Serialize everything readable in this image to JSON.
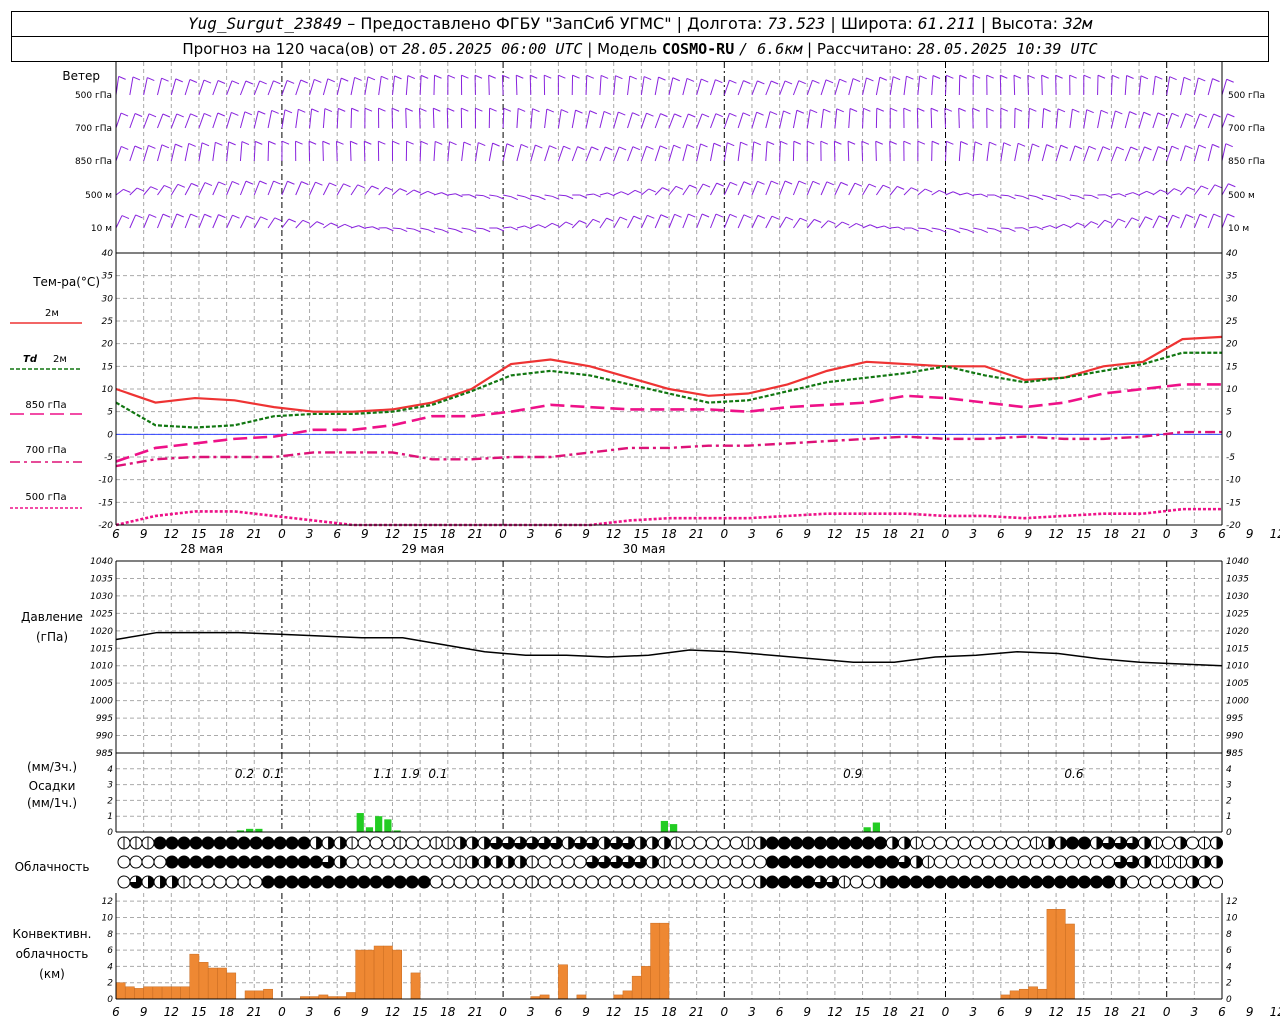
{
  "header": {
    "station": "Yug_Surgut_23849",
    "provider": "– Предоставлено ФГБУ \"ЗапСиб УГМС\"",
    "lon_label": "| Долгота:",
    "lon": "73.523",
    "lat_label": "| Широта:",
    "lat": "61.211",
    "alt_label": "| Высота:",
    "alt": "32м",
    "fc_label": "Прогноз на 120 часа(ов) от",
    "fc_start": "28.05.2025 06:00 UTC",
    "model_label": "| Модель",
    "model": "COSMO-RU",
    "res": "/ 6.6км",
    "calc_label": "| Рассчитано:",
    "calc_time": "28.05.2025 10:39 UTC"
  },
  "labels": {
    "wind": "Ветер",
    "wind_levels": [
      "500 гПа",
      "700 гПа",
      "850 гПа",
      "500 м",
      "10 м"
    ],
    "temp": "Тем-ра(°C)",
    "t2m": "2м",
    "td": "Td",
    "td2m": "2м",
    "t850": "850 гПа",
    "t700": "700 гПа",
    "t500": "500 гПа",
    "pressure": "Давление",
    "pressure_unit": "(гПа)",
    "precip_unit3": "(мм/3ч.)",
    "precip": "Осадки",
    "precip_unit1": "(мм/1ч.)",
    "cloud": "Облачность",
    "conv1": "Конвективн.",
    "conv2": "облачность",
    "conv3": "(км)",
    "days": [
      "28 мая",
      "29 мая",
      "30 мая"
    ]
  },
  "colors": {
    "t2m": "#ee3333",
    "td": "#117711",
    "t850": "#ee1188",
    "t700": "#dd1177",
    "t500": "#ee1188",
    "wind": "#8822dd",
    "precip": "#22cc22",
    "conv": "#ee8833",
    "zero": "#3344ff"
  },
  "chart_data": {
    "type": "line",
    "x_hours": [
      0,
      3,
      6,
      9,
      12,
      15,
      18,
      21,
      24,
      27,
      30,
      33,
      36,
      39,
      42,
      45,
      48,
      51,
      54,
      57,
      60,
      63,
      66,
      69,
      72,
      75,
      78,
      81,
      84,
      87,
      90,
      93,
      96,
      99,
      102,
      105,
      108,
      111,
      114,
      117,
      120
    ],
    "x_tick_labels": [
      "6",
      "9",
      "12",
      "15",
      "18",
      "21",
      "0",
      "3",
      "6",
      "9",
      "12",
      "15",
      "18",
      "21",
      "0",
      "3",
      "6",
      "9",
      "12",
      "15",
      "18",
      "21",
      "0",
      "3",
      "6",
      "9",
      "12",
      "15",
      "18",
      "21",
      "0",
      "3",
      "6",
      "9",
      "12",
      "15",
      "18",
      "21",
      "0",
      "3",
      "6",
      "9",
      "12"
    ],
    "temperature": {
      "ylim": [
        -20,
        40
      ],
      "y_ticks": [
        -20,
        -15,
        -10,
        -5,
        0,
        5,
        10,
        15,
        20,
        25,
        30,
        35,
        40
      ],
      "series": [
        {
          "name": "2м",
          "values": [
            10,
            7,
            8,
            7.5,
            6,
            5,
            5,
            5.5,
            7,
            10,
            15.5,
            16.5,
            15,
            12.5,
            10,
            8.5,
            9,
            11,
            14,
            16,
            15.5,
            15,
            15,
            12,
            12.5,
            15,
            16,
            21,
            21.5
          ]
        },
        {
          "name": "Td 2м",
          "values": [
            7,
            2,
            1.5,
            2,
            4,
            4.5,
            4.5,
            5,
            6.5,
            9.5,
            13,
            14,
            13,
            11,
            9,
            7,
            7.5,
            9.5,
            11.5,
            12.5,
            13.5,
            15,
            13,
            11.5,
            12.5,
            14,
            15.5,
            18,
            18
          ]
        },
        {
          "name": "850 гПа",
          "values": [
            -6,
            -3,
            -2,
            -1,
            -0.5,
            1,
            1,
            2,
            4,
            4,
            5,
            6.5,
            6,
            5.5,
            5.5,
            5.5,
            5,
            6,
            6.5,
            7,
            8.5,
            8,
            7,
            6,
            7,
            9,
            10,
            11,
            11
          ]
        },
        {
          "name": "700 гПа",
          "values": [
            -7,
            -5.5,
            -5,
            -5,
            -5,
            -4,
            -4,
            -4,
            -5.5,
            -5.5,
            -5,
            -5,
            -4,
            -3,
            -3,
            -2.5,
            -2.5,
            -2,
            -1.5,
            -1,
            -0.5,
            -1,
            -1,
            -0.5,
            -1,
            -1,
            -0.5,
            0.5,
            0.5
          ]
        },
        {
          "name": "500 гПа",
          "values": [
            -20,
            -18,
            -17,
            -17,
            -18,
            -19,
            -20,
            -21,
            -21.5,
            -21,
            -20.5,
            -20.5,
            -20,
            -19,
            -18.5,
            -18.5,
            -18.5,
            -18,
            -17.5,
            -17.5,
            -17.5,
            -18,
            -18,
            -18.5,
            -18,
            -17.5,
            -17.5,
            -16.5,
            -16.5
          ]
        }
      ]
    },
    "pressure": {
      "ylim": [
        985,
        1040
      ],
      "y_ticks": [
        985,
        990,
        995,
        1000,
        1005,
        1010,
        1015,
        1020,
        1025,
        1030,
        1035,
        1040
      ],
      "values": [
        1017.5,
        1019.5,
        1019.5,
        1019.5,
        1019,
        1018.5,
        1018,
        1018,
        1016,
        1014,
        1013,
        1013,
        1012.5,
        1013,
        1014.5,
        1014,
        1013,
        1012,
        1011,
        1011,
        1012.5,
        1013,
        1014,
        1013.5,
        1012,
        1011,
        1010.5,
        1010
      ]
    },
    "precipitation": {
      "ylim": [
        0,
        5
      ],
      "y_ticks": [
        0,
        1,
        2,
        3,
        4,
        5
      ],
      "totals_3h": [
        {
          "hour": 12,
          "label": "0.2"
        },
        {
          "hour": 15,
          "label": "0.1"
        },
        {
          "hour": 27,
          "label": "1.1"
        },
        {
          "hour": 30,
          "label": "1.9"
        },
        {
          "hour": 33,
          "label": "0.1"
        },
        {
          "hour": 78,
          "label": "0.9"
        },
        {
          "hour": 102,
          "label": "0.6"
        }
      ],
      "hourly": [
        {
          "hour": 13,
          "value": 0.1
        },
        {
          "hour": 14,
          "value": 0.2
        },
        {
          "hour": 15,
          "value": 0.2
        },
        {
          "hour": 26,
          "value": 1.2
        },
        {
          "hour": 27,
          "value": 0.3
        },
        {
          "hour": 28,
          "value": 1.0
        },
        {
          "hour": 29,
          "value": 0.8
        },
        {
          "hour": 30,
          "value": 0.1
        },
        {
          "hour": 59,
          "value": 0.7
        },
        {
          "hour": 60,
          "value": 0.5
        },
        {
          "hour": 81,
          "value": 0.3
        },
        {
          "hour": 82,
          "value": 0.6
        }
      ]
    },
    "convective_cloud": {
      "ylim": [
        0,
        13
      ],
      "y_ticks": [
        0,
        2,
        4,
        6,
        8,
        10,
        12
      ],
      "bars": [
        {
          "hour": 0,
          "value": 2
        },
        {
          "hour": 1,
          "value": 1.5
        },
        {
          "hour": 2,
          "value": 1.3
        },
        {
          "hour": 3,
          "value": 1.5
        },
        {
          "hour": 4,
          "value": 1.5
        },
        {
          "hour": 5,
          "value": 1.5
        },
        {
          "hour": 6,
          "value": 1.5
        },
        {
          "hour": 7,
          "value": 1.5
        },
        {
          "hour": 8,
          "value": 5.5
        },
        {
          "hour": 9,
          "value": 4.5
        },
        {
          "hour": 10,
          "value": 3.8
        },
        {
          "hour": 11,
          "value": 3.8
        },
        {
          "hour": 12,
          "value": 3.2
        },
        {
          "hour": 14,
          "value": 1
        },
        {
          "hour": 15,
          "value": 1
        },
        {
          "hour": 16,
          "value": 1.2
        },
        {
          "hour": 20,
          "value": 0.3
        },
        {
          "hour": 21,
          "value": 0.3
        },
        {
          "hour": 22,
          "value": 0.5
        },
        {
          "hour": 23,
          "value": 0.3
        },
        {
          "hour": 24,
          "value": 0.3
        },
        {
          "hour": 25,
          "value": 0.8
        },
        {
          "hour": 26,
          "value": 6
        },
        {
          "hour": 27,
          "value": 6
        },
        {
          "hour": 28,
          "value": 6.5
        },
        {
          "hour": 29,
          "value": 6.5
        },
        {
          "hour": 30,
          "value": 6
        },
        {
          "hour": 32,
          "value": 3.2
        },
        {
          "hour": 45,
          "value": 0.3
        },
        {
          "hour": 46,
          "value": 0.5
        },
        {
          "hour": 48,
          "value": 4.2
        },
        {
          "hour": 50,
          "value": 0.5
        },
        {
          "hour": 54,
          "value": 0.5
        },
        {
          "hour": 55,
          "value": 1
        },
        {
          "hour": 56,
          "value": 2.8
        },
        {
          "hour": 57,
          "value": 4
        },
        {
          "hour": 58,
          "value": 9.3
        },
        {
          "hour": 59,
          "value": 9.3
        },
        {
          "hour": 96,
          "value": 0.5
        },
        {
          "hour": 97,
          "value": 1
        },
        {
          "hour": 98,
          "value": 1.2
        },
        {
          "hour": 99,
          "value": 1.5
        },
        {
          "hour": 100,
          "value": 1.2
        },
        {
          "hour": 101,
          "value": 11
        },
        {
          "hour": 102,
          "value": 11
        },
        {
          "hour": 103,
          "value": 9.2
        }
      ]
    },
    "cloudiness": {
      "rows": 3,
      "levels": [
        [
          1,
          1,
          1,
          4,
          4,
          4,
          4,
          4,
          4,
          4,
          4,
          4,
          4,
          4,
          4,
          4,
          2,
          2,
          2,
          1,
          0,
          0,
          0,
          1,
          0,
          0,
          1,
          1,
          2,
          2,
          2,
          3,
          3,
          3,
          3,
          3,
          3,
          2,
          3,
          3,
          2,
          3,
          3,
          2,
          2,
          2,
          1,
          0,
          0,
          0,
          0,
          0,
          1,
          2,
          4,
          4,
          4,
          4,
          4,
          4,
          4,
          4,
          4,
          4,
          2,
          2,
          1,
          0,
          0,
          0,
          0,
          0,
          0,
          0,
          0,
          0,
          1,
          2,
          2,
          4,
          4,
          2,
          3,
          3,
          3,
          2,
          1,
          0,
          2,
          0,
          1,
          2
        ],
        [
          0,
          0,
          0,
          0,
          4,
          4,
          4,
          4,
          4,
          4,
          4,
          4,
          4,
          4,
          4,
          4,
          4,
          3,
          2,
          0,
          0,
          0,
          0,
          0,
          0,
          0,
          0,
          0,
          1,
          2,
          2,
          2,
          2,
          2,
          1,
          0,
          0,
          0,
          0,
          3,
          3,
          3,
          3,
          3,
          2,
          1,
          0,
          0,
          0,
          0,
          0,
          0,
          0,
          0,
          4,
          4,
          4,
          4,
          4,
          4,
          4,
          4,
          4,
          4,
          4,
          3,
          2,
          1,
          0,
          0,
          0,
          0,
          0,
          0,
          0,
          0,
          0,
          0,
          0,
          0,
          0,
          0,
          0,
          3,
          3,
          2,
          1,
          1,
          1,
          2,
          2,
          2
        ],
        [
          0,
          3,
          2,
          2,
          2,
          1,
          0,
          0,
          0,
          0,
          0,
          0,
          4,
          4,
          4,
          4,
          4,
          4,
          4,
          4,
          4,
          4,
          4,
          4,
          4,
          4,
          0,
          0,
          0,
          0,
          0,
          0,
          0,
          0,
          1,
          0,
          0,
          0,
          0,
          0,
          0,
          0,
          0,
          0,
          0,
          0,
          0,
          0,
          0,
          0,
          0,
          0,
          0,
          2,
          4,
          4,
          4,
          4,
          3,
          3,
          1,
          0,
          0,
          2,
          4,
          4,
          4,
          4,
          4,
          4,
          4,
          4,
          4,
          4,
          4,
          4,
          4,
          4,
          4,
          4,
          4,
          4,
          4,
          2,
          0,
          0,
          0,
          0,
          0,
          2,
          0,
          0
        ]
      ]
    },
    "wind_levels_count": 5
  }
}
